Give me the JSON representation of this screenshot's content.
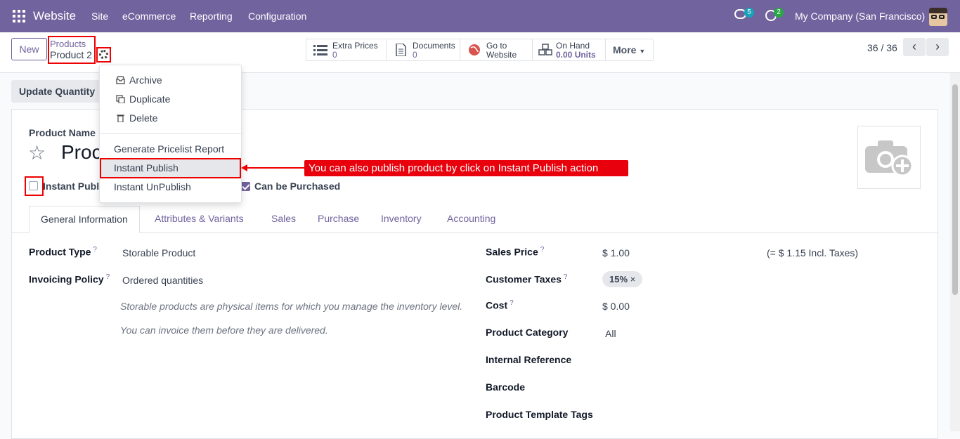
{
  "navbar": {
    "brand": "Website",
    "menus": [
      "Site",
      "eCommerce",
      "Reporting",
      "Configuration"
    ],
    "messages_count": "5",
    "activities_count": "2",
    "company": "My Company (San Francisco)"
  },
  "control_panel": {
    "new_label": "New",
    "breadcrumb_parent": "Products",
    "breadcrumb_current": "Product 2",
    "smart_buttons": [
      {
        "label": "Extra Prices",
        "value": "0",
        "icon": "list-icon"
      },
      {
        "label": "Documents",
        "value": "0",
        "icon": "document-icon"
      },
      {
        "label": "Go to",
        "value": "Website",
        "icon": "globe-icon"
      },
      {
        "label": "On Hand",
        "value": "0.00 Units",
        "icon": "cubes-icon"
      }
    ],
    "more_label": "More",
    "pager": "36 / 36"
  },
  "dropdown": {
    "items": [
      "Archive",
      "Duplicate",
      "Delete",
      "Generate Pricelist Report",
      "Instant Publish",
      "Instant UnPublish"
    ]
  },
  "annotation": {
    "callout": "You can also publish product by click on Instant Publish action"
  },
  "form": {
    "update_quantity": "Update Quantity",
    "product_name_label": "Product Name",
    "product_name_visible": "Proc",
    "instant_publish_label": "Instant Publi",
    "can_be_purchased_label": "Can be Purchased",
    "can_be_purchased_checked": true,
    "tabs": [
      "General Information",
      "Attributes & Variants",
      "Sales",
      "Purchase",
      "Inventory",
      "Accounting"
    ],
    "left": {
      "product_type_label": "Product Type",
      "product_type_value": "Storable Product",
      "invoicing_policy_label": "Invoicing Policy",
      "invoicing_policy_value": "Ordered quantities",
      "help1": "Storable products are physical items for which you manage the inventory level.",
      "help2": "You can invoice them before they are delivered."
    },
    "right": {
      "sales_price_label": "Sales Price",
      "sales_price_value": "$ 1.00",
      "incl_taxes": "(= $ 1.15 Incl. Taxes)",
      "customer_taxes_label": "Customer Taxes",
      "customer_taxes_tag": "15%",
      "cost_label": "Cost",
      "cost_value": "$ 0.00",
      "category_label": "Product Category",
      "category_value": "All",
      "internal_ref_label": "Internal Reference",
      "barcode_label": "Barcode",
      "template_tags_label": "Product Template Tags"
    },
    "help_marker": "?"
  }
}
